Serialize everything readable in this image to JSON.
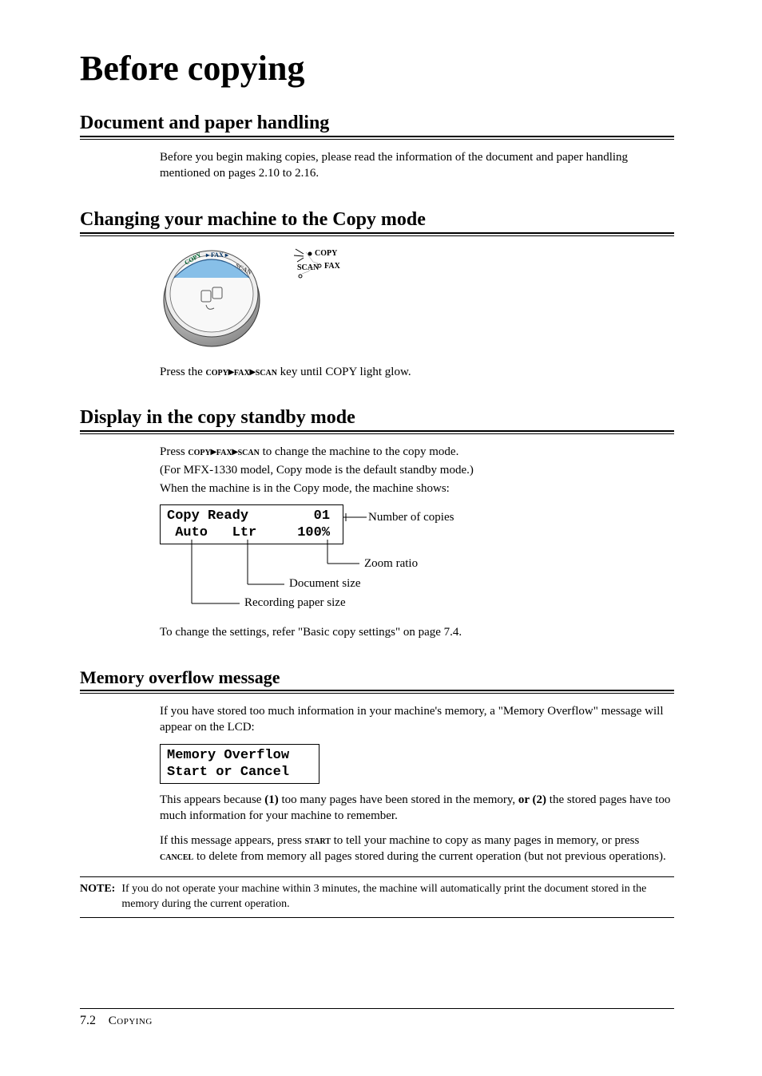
{
  "title": "Before copying",
  "sections": {
    "doc_handling": {
      "heading": "Document and paper handling",
      "para": "Before you begin making copies, please read the information of the document and paper handling mentioned on pages 2.10 to 2.16."
    },
    "changing_mode": {
      "heading": "Changing your machine to the Copy mode",
      "caption_pre": "Press the ",
      "caption_key": "copy▸fax▸scan",
      "caption_post": " key until COPY light glow."
    },
    "display": {
      "heading": "Display in the copy standby mode",
      "line1_pre": "Press ",
      "line1_key": "copy▸fax▸scan",
      "line1_post": " to change the machine to the copy mode.",
      "line2": "(For MFX-1330 model, Copy mode is the default standby mode.)",
      "line3": "When the machine is in the Copy mode, the machine shows:",
      "lcd_line1": "Copy Ready        01",
      "lcd_line2": " Auto   Ltr     100%",
      "callouts": {
        "copies": "Number of copies",
        "zoom": "Zoom ratio",
        "docsize": "Document size",
        "recsize": "Recording paper size"
      },
      "after": "To change the settings, refer \"Basic copy settings\" on page 7.4."
    },
    "overflow": {
      "heading": "Memory overflow message",
      "para1": "If you have stored too much information in your machine's memory, a \"Memory Overflow\" message will appear on the LCD:",
      "lcd_line1": "Memory Overflow",
      "lcd_line2": "Start or Cancel",
      "para2_a": "This appears because ",
      "para2_b": "(1)",
      "para2_c": " too many pages have been stored in the memory, ",
      "para2_d": "or (2)",
      "para2_e": " the stored pages have too much information for your machine to remember.",
      "para3_pre": "If this message appears, press ",
      "para3_k1": "start",
      "para3_mid": " to tell your machine to copy as many pages in memory, or press ",
      "para3_k2": "cancel",
      "para3_post": " to delete from memory all pages stored during the current operation (but not previous operations).",
      "note_label": "NOTE:",
      "note_body": "If you do not operate your machine within 3 minutes, the machine will automatically print the document stored in the memory during the current operation."
    }
  },
  "footer": {
    "page": "7.2",
    "chapter": "Copying"
  }
}
